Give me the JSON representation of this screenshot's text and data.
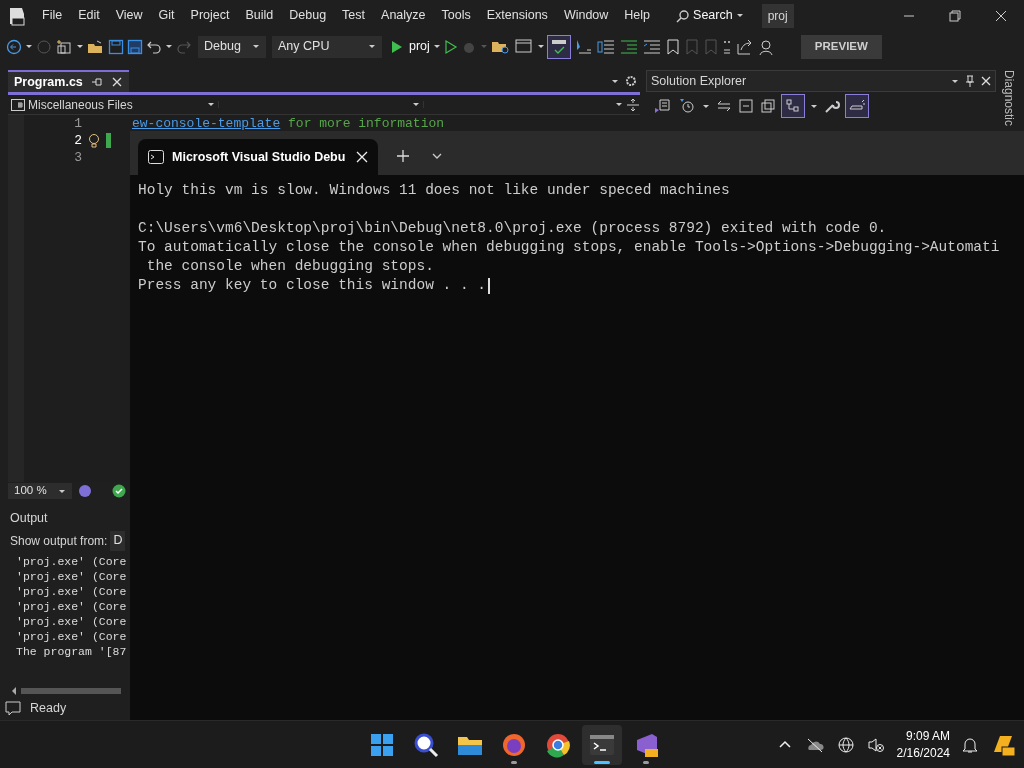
{
  "menu": [
    "File",
    "Edit",
    "View",
    "Git",
    "Project",
    "Build",
    "Debug",
    "Test",
    "Analyze",
    "Tools",
    "Extensions",
    "Window",
    "Help"
  ],
  "search": {
    "label": "Search"
  },
  "solution_name": "proj",
  "toolbar": {
    "configuration": "Debug",
    "platform": "Any CPU",
    "run_target": "proj",
    "spell_check_on": true,
    "preview": "PREVIEW"
  },
  "editor": {
    "tab": {
      "label": "Program.cs",
      "selected": true
    },
    "project": "Miscellaneous Files",
    "lines": [
      {
        "number": "1",
        "current": false,
        "link": "ew-console-template",
        "comment": " for more information"
      },
      {
        "number": "2",
        "current": true
      },
      {
        "number": "3",
        "current": false
      }
    ],
    "zoom": "100 %"
  },
  "output": {
    "title": "Output",
    "show_from_label": "Show output from:",
    "source": "D",
    "lines": [
      "'proj.exe' (Core",
      "'proj.exe' (Core",
      "'proj.exe' (Core",
      "'proj.exe' (Core",
      "'proj.exe' (Core",
      "'proj.exe' (Core",
      "The program '[87"
    ]
  },
  "status": "Ready",
  "solution_explorer": {
    "title": "Solution Explorer",
    "sync_on": true,
    "preview_on": true
  },
  "side_tab": "Diagnostic",
  "terminal": {
    "tab_title": "Microsoft Visual Studio Debu",
    "cursor_visible": true,
    "paragraphs": [
      [
        "Holy this vm is slow. Windows 11 does not like under speced machines"
      ],
      [
        "C:\\Users\\vm6\\Desktop\\proj\\bin\\Debug\\net8.0\\proj.exe (process 8792) exited with code 0.",
        "To automatically close the console when debugging stops, enable Tools->Options->Debugging->Automati",
        " the console when debugging stops.",
        "Press any key to close this window . . ."
      ]
    ]
  },
  "taskbar": {
    "apps": [
      {
        "kind": "start",
        "selected": false,
        "running": false
      },
      {
        "kind": "search",
        "selected": false,
        "running": false
      },
      {
        "kind": "files",
        "selected": false,
        "running": false
      },
      {
        "kind": "firefox",
        "selected": false,
        "running": true
      },
      {
        "kind": "chrome",
        "selected": false,
        "running": false
      },
      {
        "kind": "terminal",
        "selected": true,
        "running": true
      },
      {
        "kind": "vs",
        "selected": false,
        "running": true
      }
    ],
    "time": "9:09 AM",
    "date": "2/16/2024"
  }
}
